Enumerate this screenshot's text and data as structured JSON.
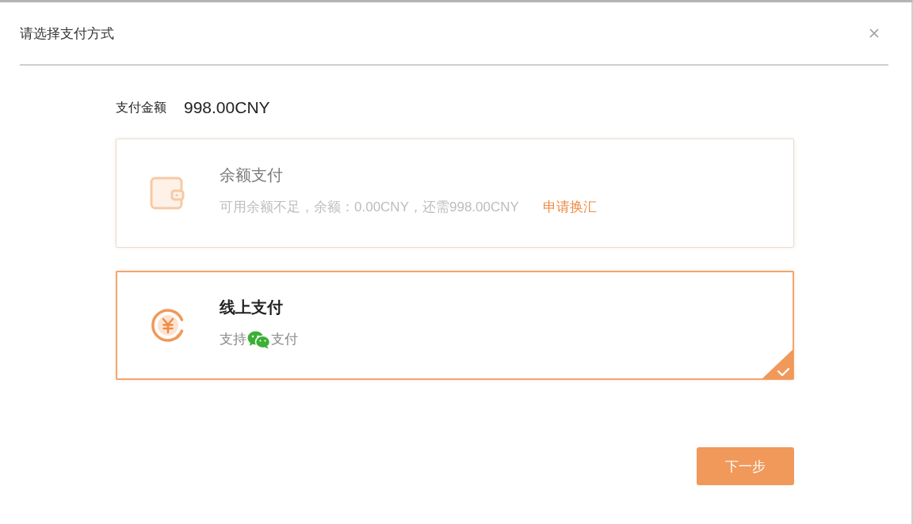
{
  "dialog": {
    "title": "请选择支付方式"
  },
  "amount": {
    "label": "支付金额",
    "value": "998.00CNY"
  },
  "payment_methods": [
    {
      "kind": "balance",
      "title": "余额支付",
      "description": "可用余额不足，余额：0.00CNY，还需998.00CNY",
      "link": "申请换汇",
      "disabled": true,
      "selected": false
    },
    {
      "kind": "online",
      "title": "线上支付",
      "description": "支持",
      "description_suffix": "支付",
      "disabled": false,
      "selected": true
    }
  ],
  "buttons": [
    "下一步"
  ]
}
